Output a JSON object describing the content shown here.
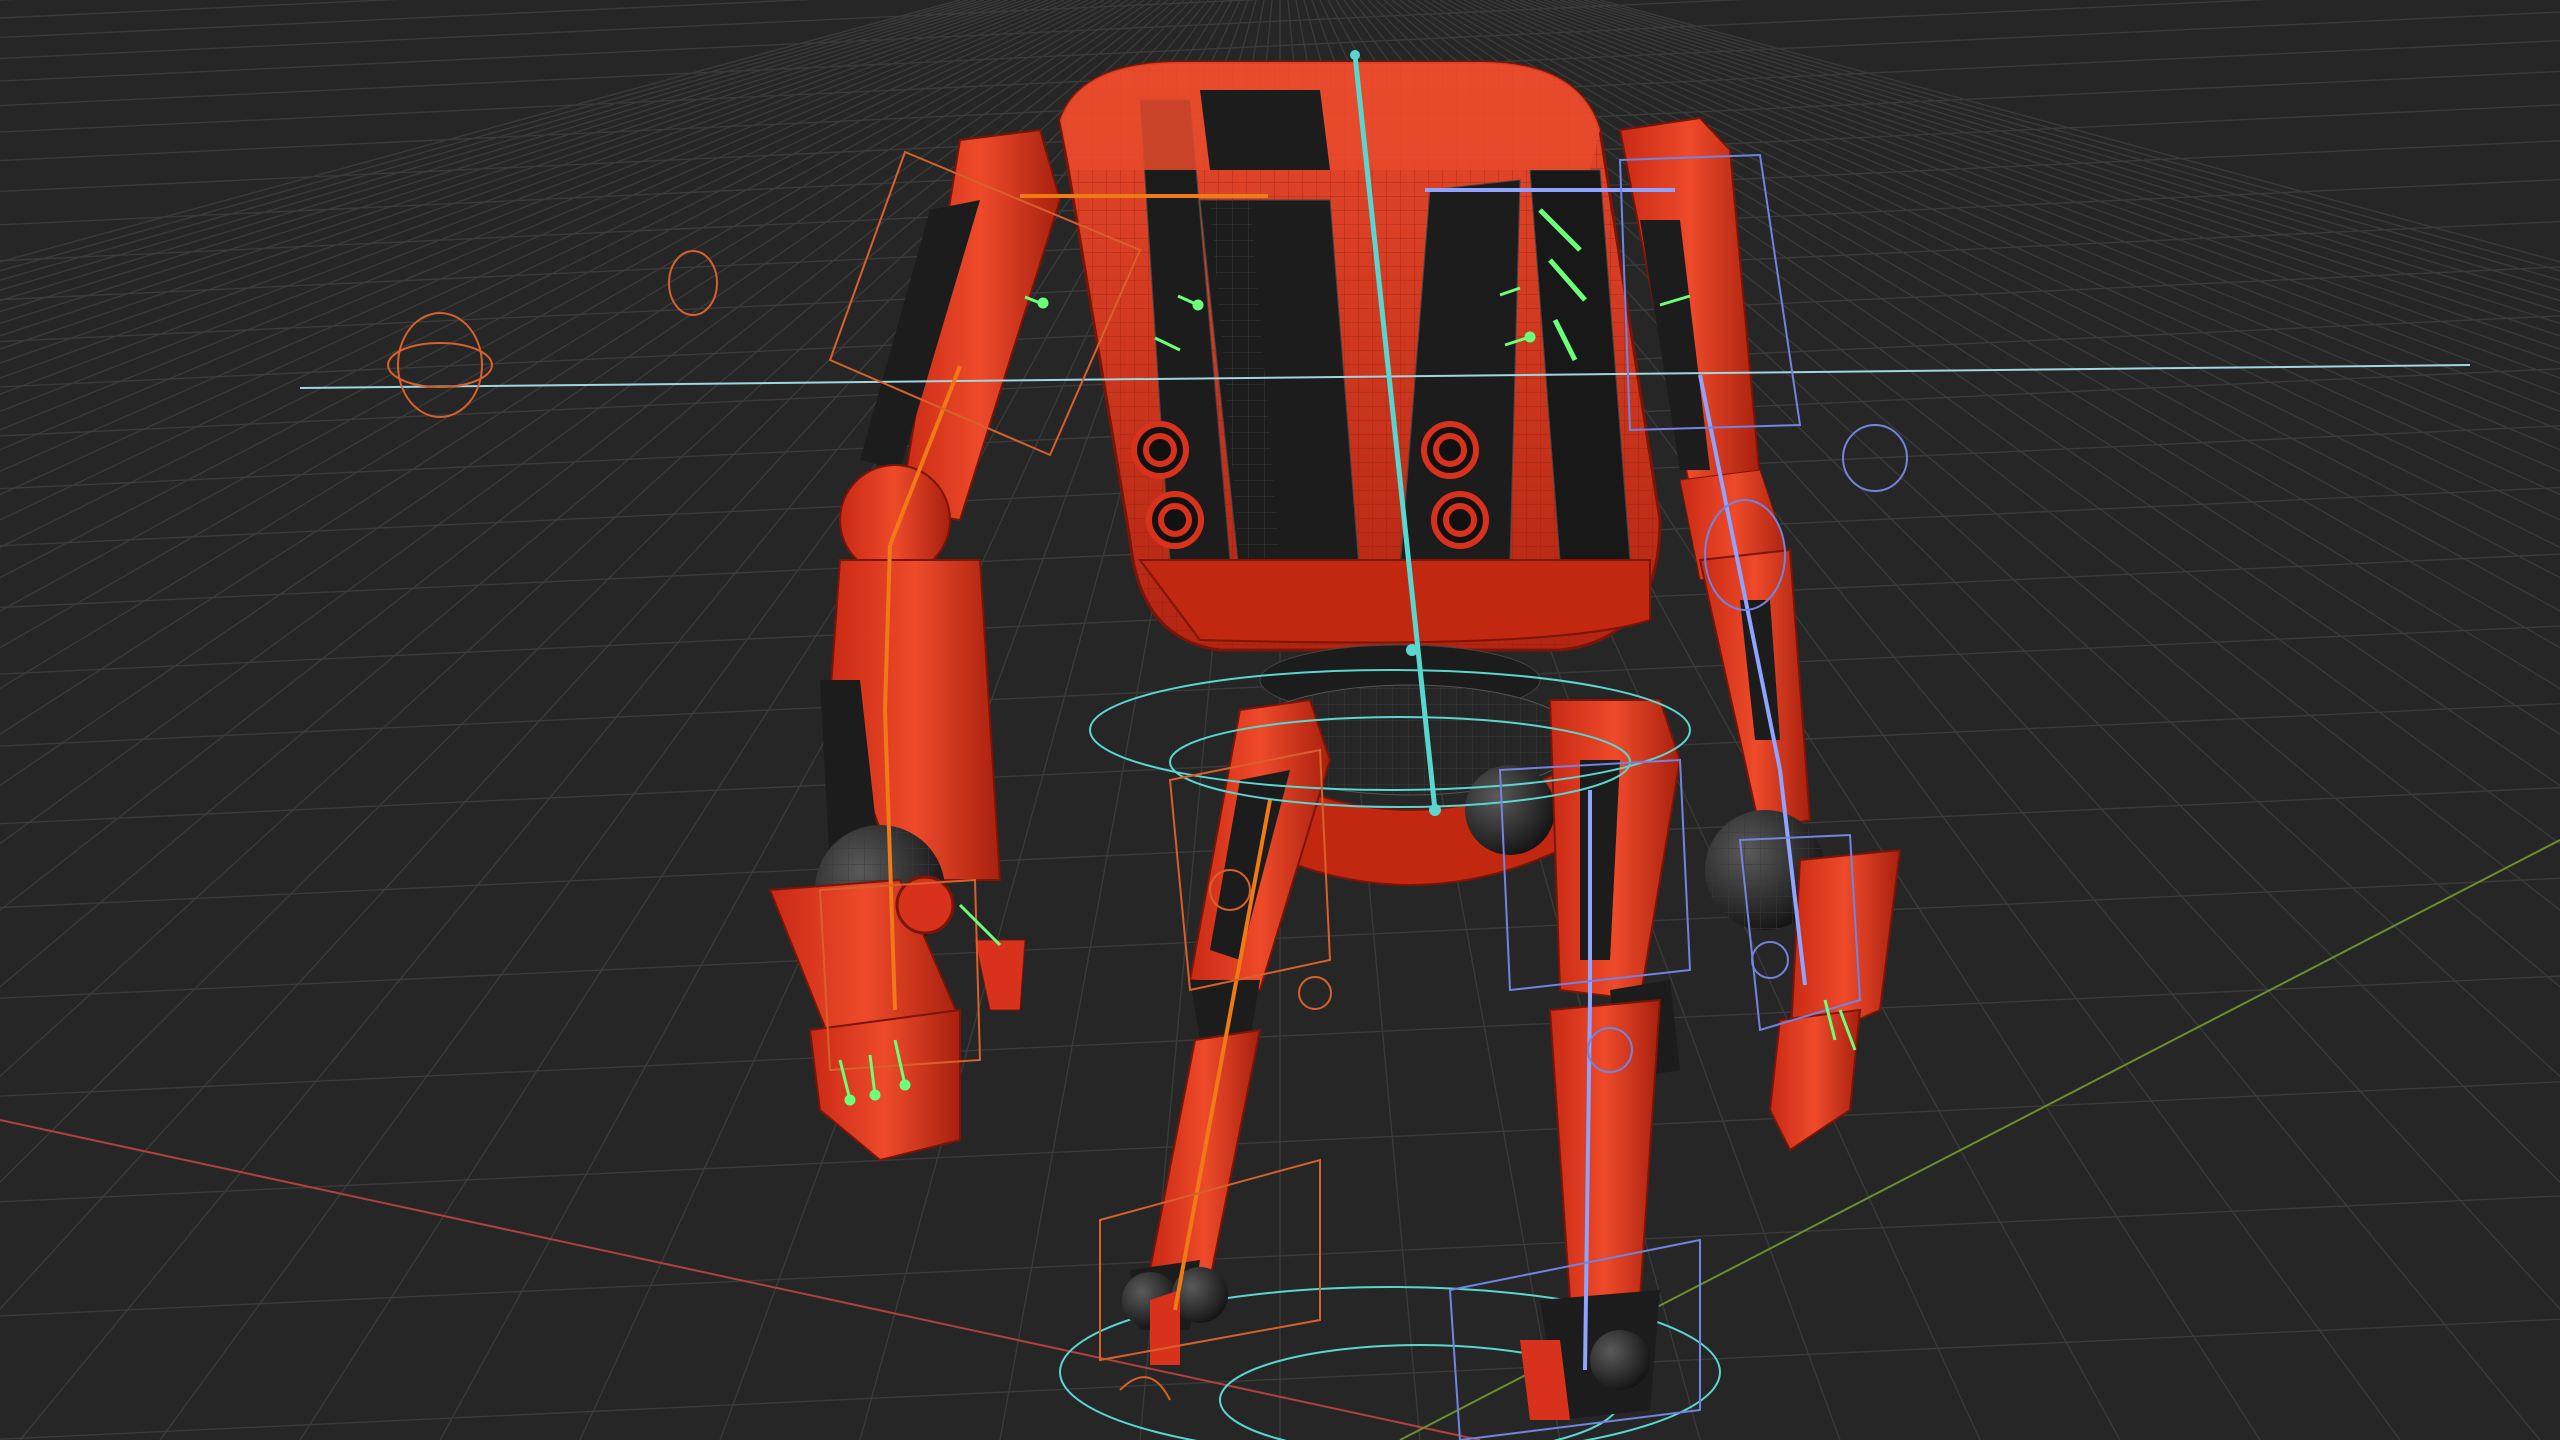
{
  "viewport": {
    "background": "#262626",
    "grid_color": "#3a3a3a",
    "x_axis_color": "#b0413e",
    "y_axis_color": "#6a8f2c"
  },
  "model": {
    "name": "",
    "mesh_color": "#d9321c",
    "mesh_dark": "#1c1c1c",
    "wire_color": "#8a1a0c"
  },
  "rig": {
    "left_side_color": "#f07a14",
    "right_side_color": "#8fa4ff",
    "center_color": "#5ad6d0",
    "ctrl_orange": "#d8602a",
    "ctrl_blue": "#7084e0",
    "joint_green": "#6bff7a"
  },
  "icons": [
    "grid-floor-icon",
    "bone-icon",
    "control-circle-icon",
    "control-box-icon"
  ]
}
